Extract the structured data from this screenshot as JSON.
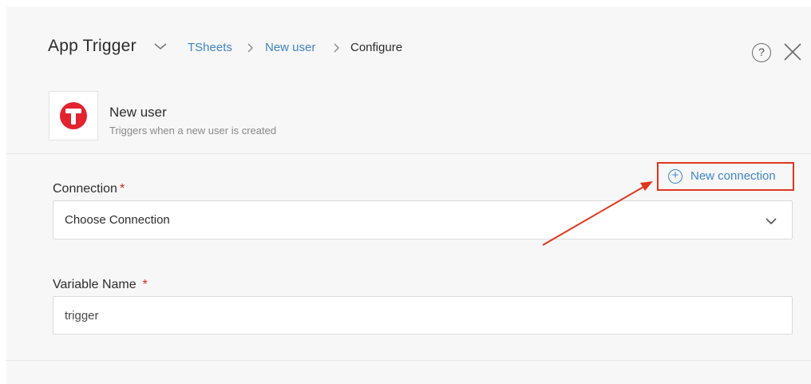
{
  "header": {
    "title": "App Trigger",
    "breadcrumbs": [
      {
        "label": "TSheets"
      },
      {
        "label": "New user"
      },
      {
        "label": "Configure"
      }
    ],
    "help_label": "?"
  },
  "trigger": {
    "name": "New user",
    "description": "Triggers when a new user is created",
    "app_icon": "tsheets-logo-icon"
  },
  "connection": {
    "label": "Connection",
    "required_mark": "*",
    "new_connection_label": "New connection",
    "selected": "Choose Connection"
  },
  "variable": {
    "label": "Variable Name",
    "required_mark": "*",
    "value": "trigger"
  },
  "colors": {
    "accent": "#3e86c8",
    "required": "#e2211c",
    "highlight": "#e0361c",
    "logo": "#e3232f"
  }
}
